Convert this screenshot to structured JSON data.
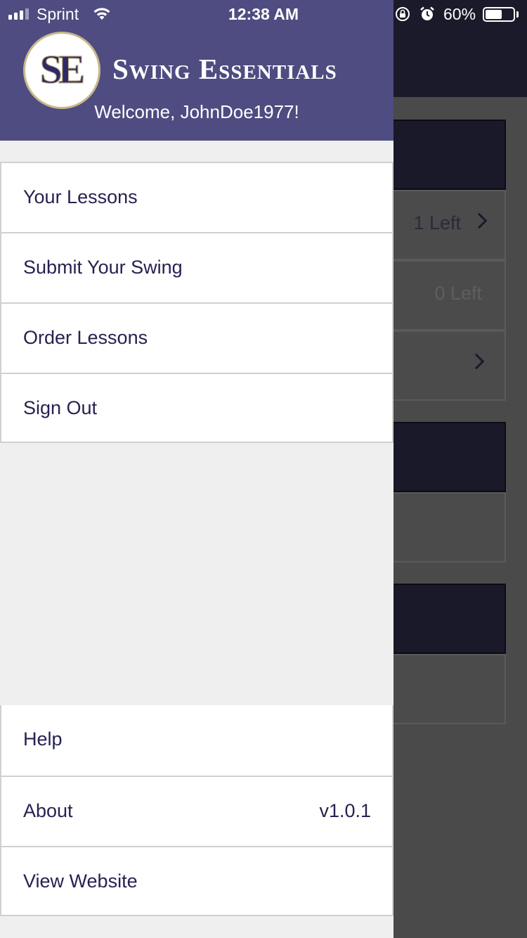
{
  "status_bar": {
    "carrier": "Sprint",
    "time": "12:38 AM",
    "battery_percent_text": "60%",
    "battery_level": 0.6,
    "icons": [
      "signal-icon",
      "wifi-icon",
      "orientation-lock-icon",
      "alarm-icon",
      "battery-icon"
    ]
  },
  "drawer": {
    "logo_text": "SE",
    "brand_title": "Swing Essentials",
    "welcome": "Welcome, JohnDoe1977!",
    "menu_top": [
      {
        "label": "Your Lessons"
      },
      {
        "label": "Submit Your Swing"
      },
      {
        "label": "Order Lessons"
      },
      {
        "label": "Sign Out"
      }
    ],
    "menu_bottom": [
      {
        "label": "Help",
        "value": ""
      },
      {
        "label": "About",
        "value": "v1.0.1"
      },
      {
        "label": "View Website",
        "value": ""
      }
    ]
  },
  "background": {
    "rows": [
      {
        "value": "1 Left"
      },
      {
        "value": "0 Left"
      }
    ]
  },
  "colors": {
    "header_purple": "#4f4c81",
    "menu_text": "#262251",
    "logo_gold": "#c9b98a",
    "overlay_dark": "#4a4a4a"
  }
}
